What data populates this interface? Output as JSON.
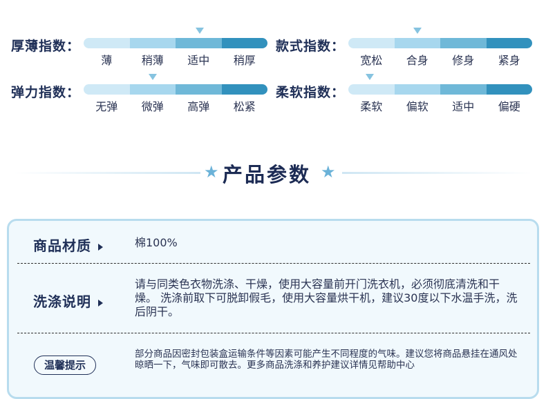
{
  "indices": [
    {
      "label": "厚薄指数：",
      "options": [
        "薄",
        "稍薄",
        "适中",
        "稍厚"
      ],
      "selected": 2
    },
    {
      "label": "款式指数：",
      "options": [
        "宽松",
        "合身",
        "修身",
        "紧身"
      ],
      "selected": 1
    },
    {
      "label": "弹力指数：",
      "options": [
        "无弹",
        "微弹",
        "高弹",
        "松紧"
      ],
      "selected": 1
    },
    {
      "label": "柔软指数：",
      "options": [
        "柔软",
        "偏软",
        "适中",
        "偏硬"
      ],
      "selected": 0
    }
  ],
  "section": {
    "title": "产品参数"
  },
  "params": {
    "material_label": "商品材质",
    "material_value": "棉100%",
    "wash_label": "洗涤说明",
    "wash_value": "请与同类色衣物洗涤、干燥，使用大容量前开门洗衣机，必须彻底清洗和干燥。 洗涤前取下可脱卸假毛，使用大容量烘干机，建议30度以下水温手洗，洗后阴干。",
    "tip_label": "温馨提示",
    "tip_value": "部分商品因密封包装盒运输条件等因素可能产生不同程度的气味。建议您将商品悬挂在通风处晾晒一下，气味即可散去。更多商品洗涤和养护建议详情见帮助中心"
  },
  "colors": {
    "seg1": "#cfe9f6",
    "seg2": "#a7d7ee",
    "seg3": "#6fb8d8",
    "seg4": "#3291bd",
    "marker": "#86c3e0",
    "card_border": "#b8dcee"
  }
}
